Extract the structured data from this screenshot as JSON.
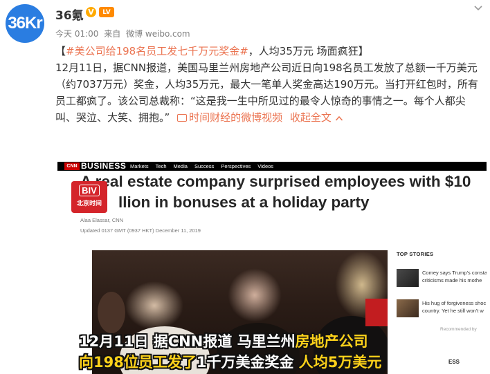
{
  "header": {
    "avatar_text": "36Kr",
    "username": "36氪",
    "verified_badge": "V",
    "level_badge": "LV",
    "time": "今天 01:00",
    "source_prefix": "来自",
    "source": "微博 weibo.com",
    "menu_icon": "chevron-down-icon"
  },
  "post": {
    "bracket_open": "【",
    "hashtag": "#美公司给198名员工发七千万元奖金#",
    "title_rest": "，人均35万元 场面疯狂】",
    "body": "12月11日，据CNN报道，美国马里兰州房地产公司近日向198名员工发放了总额一千万美元（约7037万元）奖金，人均35万元，最大一笔单人奖金高达190万元。当打开红包时，所有员工都疯了。该公司总裁称：“这是我一生中所见过的最令人惊奇的事情之一。每个人都尖叫、哭泣、大笑、拥抱。”",
    "video_link": "时间财经的微博视频",
    "collapse_link": "收起全文",
    "accent_color": "#eb7350"
  },
  "media": {
    "cnn_logo": "CNN",
    "section": "BUSINESS",
    "nav": [
      "Markets",
      "Tech",
      "Media",
      "Success",
      "Perspectives",
      "Videos"
    ],
    "headline_line1": "A real estate company surprised employees with $10",
    "headline_line2": "llion in bonuses at a holiday party",
    "byline": "Alaa Elassar, CNN",
    "updated": "Updated 0137 GMT (0937 HKT) December 11, 2019",
    "watermark_top": "BIV",
    "watermark_bottom": "北京时间",
    "sidebar_title": "TOP STORIES",
    "story1": "Comey says Trump's consta criticisms made his mothe",
    "story2": "His hug of forgiveness shoc country. Yet he still won't w",
    "recommended": "Recommended by",
    "sidebar_footer": "ESS",
    "caption_line1_white": "12月11日 据CNN报道 马里兰州",
    "caption_line1_yellow": "房地产公司",
    "caption_line2_yellow_a": "向198位员工发了",
    "caption_line2_white_a": "1千万美金奖金",
    "caption_line2_yellow_b": " 人均",
    "caption_line2_yellow_c": "5万美元"
  }
}
